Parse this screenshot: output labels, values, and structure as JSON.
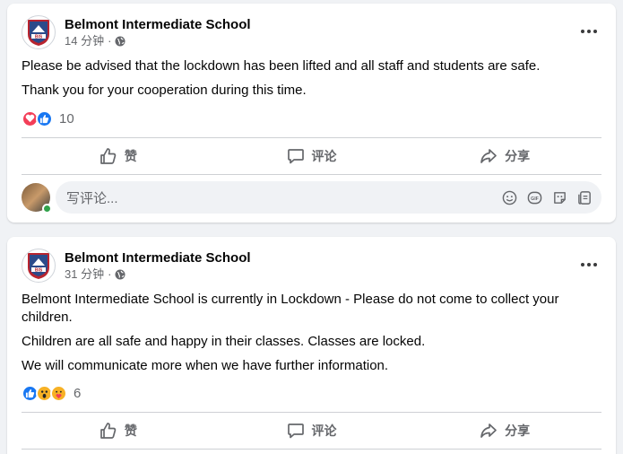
{
  "posts": [
    {
      "author": "Belmont Intermediate School",
      "time": "14 分钟",
      "time_sep": "·",
      "paragraphs": [
        "Please be advised that the lockdown has been lifted and all staff and students are safe.",
        "Thank you for your cooperation during this time."
      ],
      "reactions": [
        "love-icon",
        "like-icon"
      ],
      "reaction_count": "10",
      "actions": {
        "like": "赞",
        "comment": "评论",
        "share": "分享"
      },
      "comment_placeholder": "写评论..."
    },
    {
      "author": "Belmont Intermediate School",
      "time": "31 分钟",
      "time_sep": "·",
      "paragraphs": [
        "Belmont Intermediate School is currently in Lockdown - Please do not come to collect your children.",
        "Children are all safe and happy in their classes. Classes are locked.",
        "We will communicate more when we have further information."
      ],
      "reactions": [
        "like-icon",
        "wow-icon",
        "care-icon"
      ],
      "reaction_count": "6",
      "actions": {
        "like": "赞",
        "comment": "评论",
        "share": "分享"
      }
    }
  ],
  "logo_text": "BIS",
  "colors": {
    "like": "#1877f2",
    "love": "#f33e58",
    "wow": "#f7b125",
    "text_secondary": "#65676b"
  }
}
